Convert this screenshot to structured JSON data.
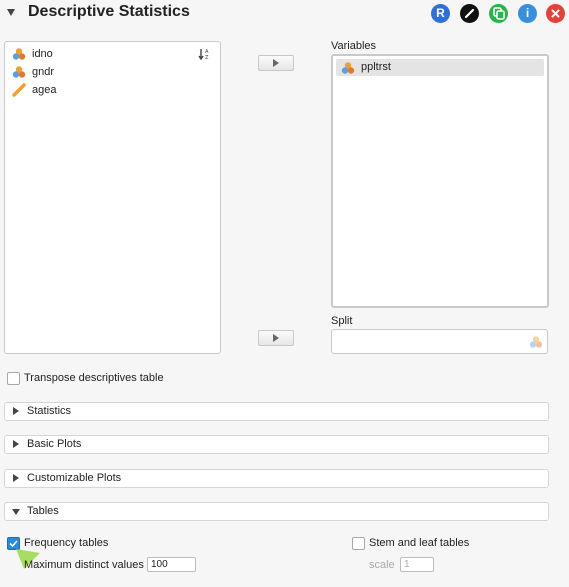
{
  "header": {
    "title": "Descriptive Statistics",
    "icons": [
      {
        "name": "r-icon",
        "label": "R",
        "color": "#2f6fd6"
      },
      {
        "name": "edit-icon",
        "label": "",
        "color": "#111111"
      },
      {
        "name": "duplicate-icon",
        "label": "",
        "color": "#28b44a"
      },
      {
        "name": "info-icon",
        "label": "i",
        "color": "#3a8fdb"
      },
      {
        "name": "close-icon",
        "label": "",
        "color": "#e0433a"
      }
    ]
  },
  "available_variables": [
    {
      "name": "idno",
      "type": "nominal"
    },
    {
      "name": "gndr",
      "type": "nominal"
    },
    {
      "name": "agea",
      "type": "scale"
    }
  ],
  "variables_label": "Variables",
  "selected_variables": [
    {
      "name": "ppltrst",
      "type": "nominal"
    }
  ],
  "split_label": "Split",
  "transpose_label": "Transpose descriptives table",
  "sections": [
    {
      "label": "Statistics",
      "expanded": false
    },
    {
      "label": "Basic Plots",
      "expanded": false
    },
    {
      "label": "Customizable Plots",
      "expanded": false
    },
    {
      "label": "Tables",
      "expanded": true
    }
  ],
  "tables": {
    "frequency_label": "Frequency tables",
    "frequency_checked": true,
    "max_distinct_label": "Maximum distinct values",
    "max_distinct_value": "100",
    "stem_leaf_label": "Stem and leaf tables",
    "stem_leaf_checked": false,
    "scale_label": "scale",
    "scale_value": "1"
  }
}
